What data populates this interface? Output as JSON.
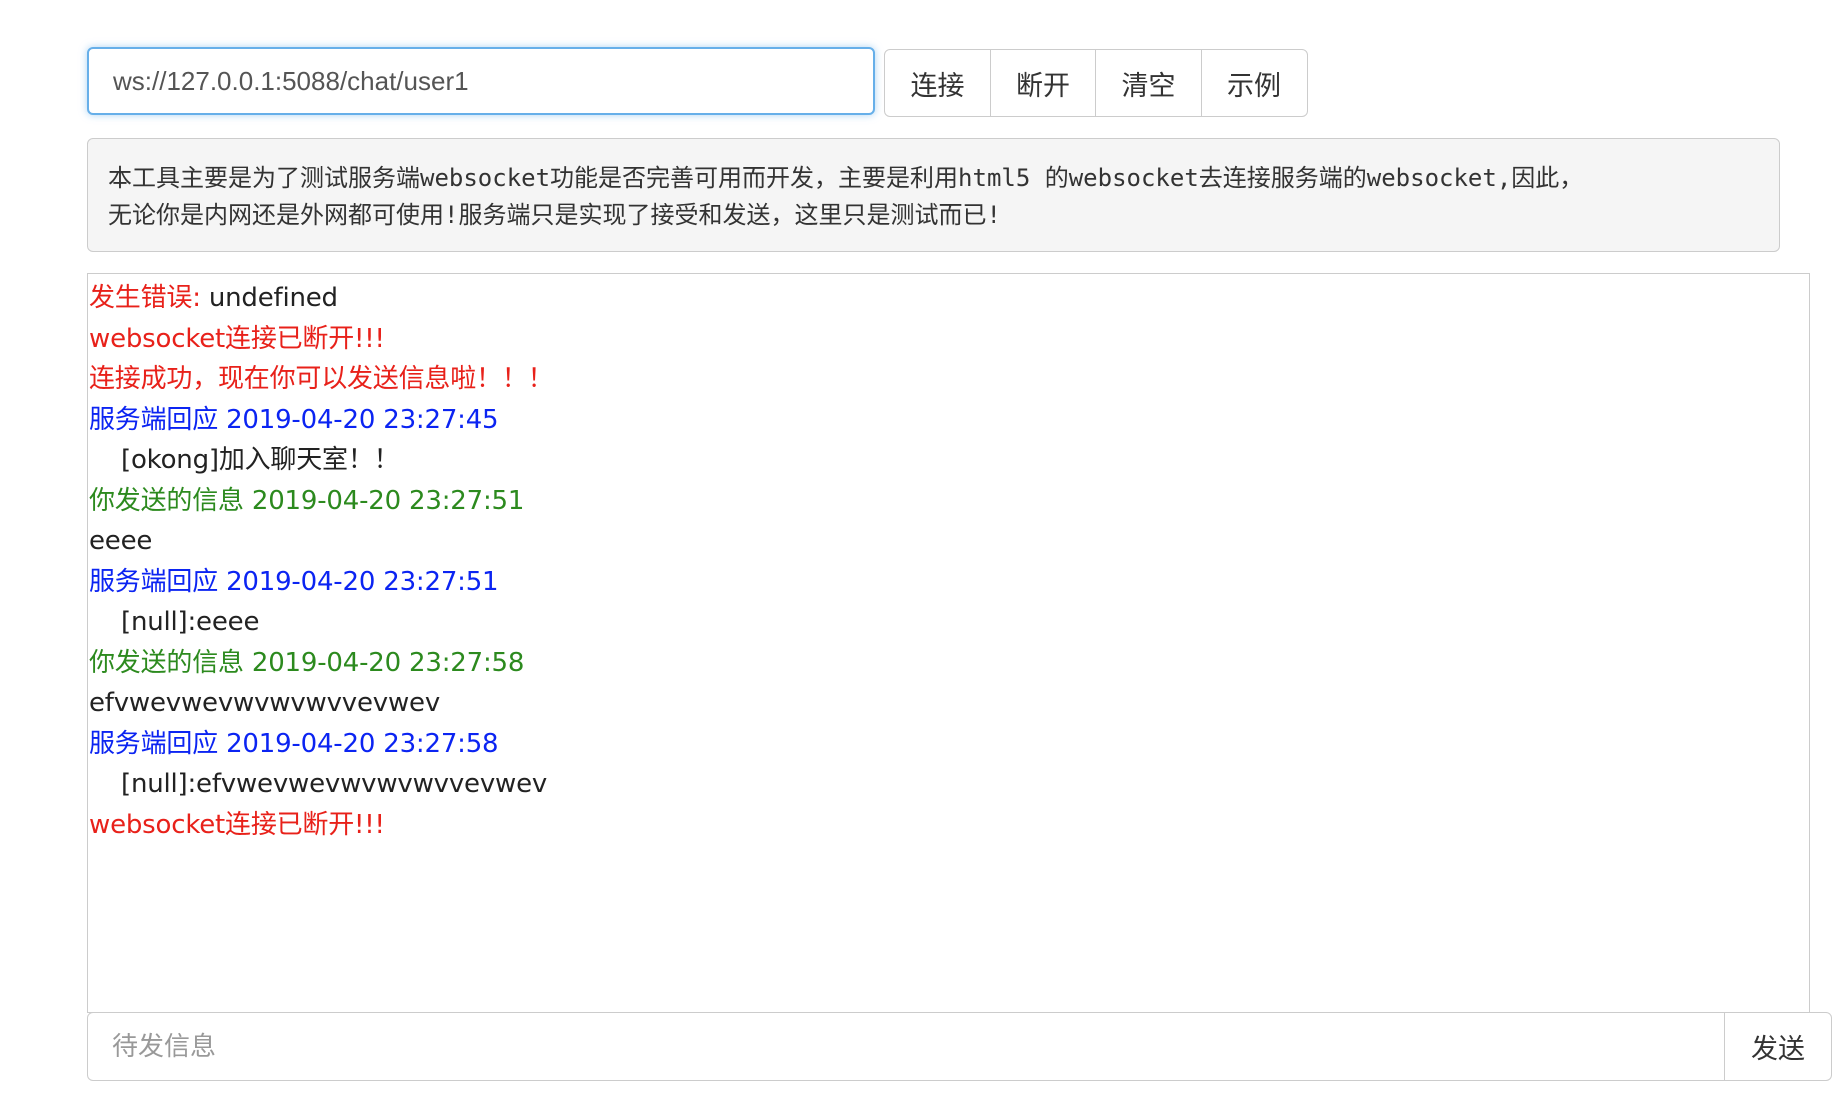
{
  "connection": {
    "url": "ws://127.0.0.1:5088/chat/user1"
  },
  "toolbar": {
    "connect_label": "连接",
    "disconnect_label": "断开",
    "clear_label": "清空",
    "example_label": "示例"
  },
  "info": {
    "line1": "本工具主要是为了测试服务端websocket功能是否完善可用而开发，主要是利用html5 的websocket去连接服务端的websocket,因此，",
    "line2": "无论你是内网还是外网都可使用!服务端只是实现了接受和发送，这里只是测试而已!"
  },
  "log": {
    "error_prefix": "发生错误:",
    "error_value": " undefined",
    "disconnected_1": "websocket连接已断开!!!",
    "connected": "连接成功，现在你可以发送信息啦！！！",
    "server_reply_1": "服务端回应 2019-04-20 23:27:45",
    "server_msg_1": "[okong]加入聊天室！！",
    "sent_1": "你发送的信息 2019-04-20 23:27:51",
    "sent_msg_1": "eeee",
    "server_reply_2": "服务端回应 2019-04-20 23:27:51",
    "server_msg_2": "[null]:eeee",
    "sent_2": "你发送的信息 2019-04-20 23:27:58",
    "sent_msg_2": "efvwevwevwvwvwvvevwev",
    "server_reply_3": "服务端回应 2019-04-20 23:27:58",
    "server_msg_3": "[null]:efvwevwevwvwvwvvevwev",
    "disconnected_2": "websocket连接已断开!!!"
  },
  "composer": {
    "placeholder": "待发信息",
    "value": "",
    "send_label": "发送"
  },
  "colors": {
    "error_red": "#e8211a",
    "server_blue": "#0b24f2",
    "sent_green": "#2c8a1e",
    "focus_blue": "#66afe9"
  }
}
